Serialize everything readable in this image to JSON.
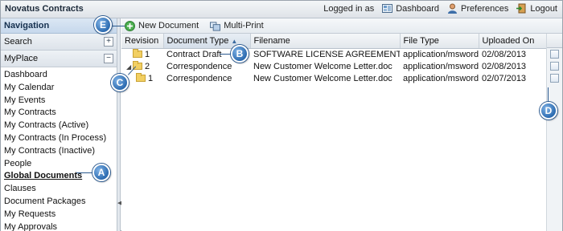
{
  "app": {
    "title": "Novatus Contracts"
  },
  "topbar": {
    "logged_in": "Logged in as",
    "dashboard": "Dashboard",
    "preferences": "Preferences",
    "logout": "Logout"
  },
  "nav": {
    "header": "Navigation",
    "search": "Search",
    "myplace": "MyPlace",
    "items": [
      "Dashboard",
      "My Calendar",
      "My Events",
      "My Contracts",
      "My Contracts (Active)",
      "My Contracts (In Process)",
      "My Contracts (Inactive)",
      "People",
      "Global Documents",
      "Clauses",
      "Document Packages",
      "My Requests",
      "My Approvals"
    ]
  },
  "toolbar": {
    "new_document": "New Document",
    "multi_print": "Multi-Print"
  },
  "table": {
    "headers": [
      "Revision",
      "Document Type",
      "Filename",
      "File Type",
      "Uploaded On"
    ],
    "rows": [
      {
        "revision": "1",
        "type": "Contract Draft",
        "filename": "SOFTWARE LICENSE AGREEMENT.docx",
        "filetype": "application/msword",
        "uploaded": "02/08/2013"
      },
      {
        "revision": "2",
        "type": "Correspondence",
        "filename": "New Customer Welcome Letter.doc",
        "filetype": "application/msword",
        "uploaded": "02/08/2013"
      },
      {
        "revision": "1",
        "type": "Correspondence",
        "filename": "New Customer Welcome Letter.doc",
        "filetype": "application/msword",
        "uploaded": "02/07/2013"
      }
    ]
  },
  "callouts": {
    "a": "A",
    "b": "B",
    "c": "C",
    "d": "D",
    "e": "E"
  }
}
